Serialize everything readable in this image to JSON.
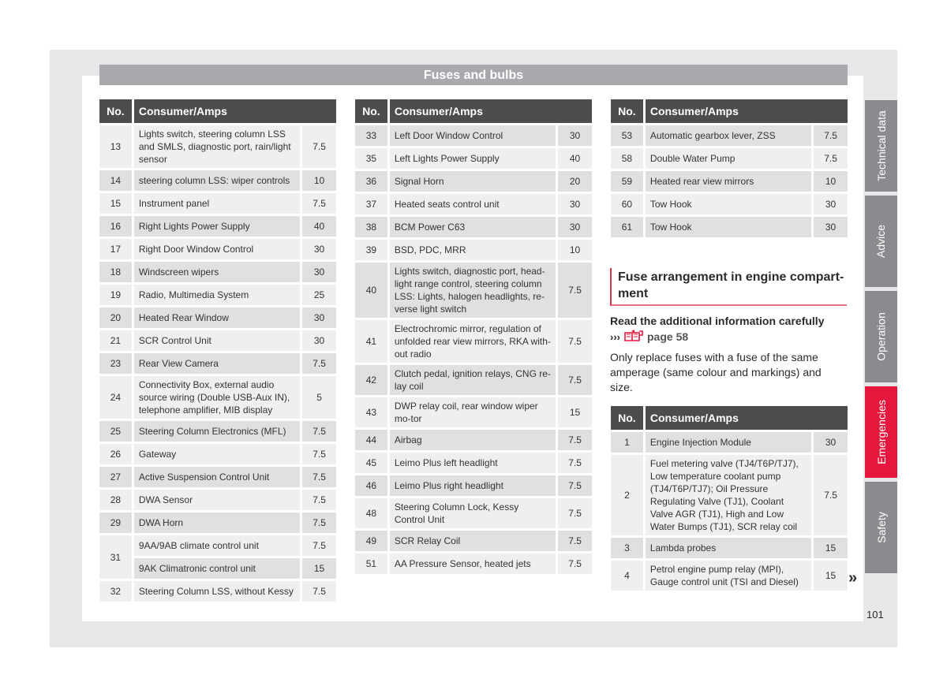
{
  "header": {
    "title": "Fuses and bulbs"
  },
  "columns": {
    "no": "No.",
    "consumer": "Consumer/Amps"
  },
  "table1": {
    "rows": [
      {
        "no": "13",
        "desc": "Lights switch, steering column LSS and SMLS, diagnostic port, rain/light sensor",
        "amps": "7.5"
      },
      {
        "no": "14",
        "desc": "steering column LSS: wiper controls",
        "amps": "10"
      },
      {
        "no": "15",
        "desc": "Instrument panel",
        "amps": "7.5"
      },
      {
        "no": "16",
        "desc": "Right Lights Power Supply",
        "amps": "40"
      },
      {
        "no": "17",
        "desc": "Right Door Window Control",
        "amps": "30"
      },
      {
        "no": "18",
        "desc": "Windscreen wipers",
        "amps": "30"
      },
      {
        "no": "19",
        "desc": "Radio, Multimedia System",
        "amps": "25"
      },
      {
        "no": "20",
        "desc": "Heated Rear Window",
        "amps": "30"
      },
      {
        "no": "21",
        "desc": "SCR Control Unit",
        "amps": "30"
      },
      {
        "no": "23",
        "desc": "Rear View Camera",
        "amps": "7.5"
      },
      {
        "no": "24",
        "desc": "Connectivity Box, external audio source wiring (Double USB-Aux IN), telephone amplifier, MIB display",
        "amps": "5"
      },
      {
        "no": "25",
        "desc": "Steering Column Electronics (MFL)",
        "amps": "7.5"
      },
      {
        "no": "26",
        "desc": "Gateway",
        "amps": "7.5"
      },
      {
        "no": "27",
        "desc": "Active Suspension Control Unit",
        "amps": "7.5"
      },
      {
        "no": "28",
        "desc": "DWA Sensor",
        "amps": "7.5"
      },
      {
        "no": "29",
        "desc": "DWA Horn",
        "amps": "7.5"
      },
      {
        "no": "31",
        "desc": "9AA/9AB climate control unit",
        "amps": "7.5"
      },
      {
        "no": "",
        "desc": "9AK Climatronic control unit",
        "amps": "15"
      },
      {
        "no": "32",
        "desc": "Steering Column LSS, without Kessy",
        "amps": "7.5"
      }
    ]
  },
  "table2": {
    "rows": [
      {
        "no": "33",
        "desc": "Left Door Window Control",
        "amps": "30"
      },
      {
        "no": "35",
        "desc": "Left Lights Power Supply",
        "amps": "40"
      },
      {
        "no": "36",
        "desc": "Signal Horn",
        "amps": "20"
      },
      {
        "no": "37",
        "desc": "Heated seats control unit",
        "amps": "30"
      },
      {
        "no": "38",
        "desc": "BCM Power C63",
        "amps": "30"
      },
      {
        "no": "39",
        "desc": "BSD, PDC, MRR",
        "amps": "10"
      },
      {
        "no": "40",
        "desc": "Lights switch, diagnostic port, head-light range control, steering column LSS: Lights, halogen headlights, re-verse light switch",
        "amps": "7.5"
      },
      {
        "no": "41",
        "desc": "Electrochromic mirror, regulation of unfolded rear view mirrors, RKA with-out radio",
        "amps": "7.5"
      },
      {
        "no": "42",
        "desc": "Clutch pedal, ignition relays, CNG re-lay coil",
        "amps": "7.5"
      },
      {
        "no": "43",
        "desc": "DWP relay coil, rear window wiper mo-tor",
        "amps": "15"
      },
      {
        "no": "44",
        "desc": "Airbag",
        "amps": "7.5"
      },
      {
        "no": "45",
        "desc": "Leimo Plus left headlight",
        "amps": "7.5"
      },
      {
        "no": "46",
        "desc": "Leimo Plus right headlight",
        "amps": "7.5"
      },
      {
        "no": "48",
        "desc": "Steering Column Lock, Kessy Control Unit",
        "amps": "7.5"
      },
      {
        "no": "49",
        "desc": "SCR Relay Coil",
        "amps": "7.5"
      },
      {
        "no": "51",
        "desc": "AA Pressure Sensor, heated jets",
        "amps": "7.5"
      }
    ]
  },
  "table3": {
    "rows": [
      {
        "no": "53",
        "desc": "Automatic gearbox lever, ZSS",
        "amps": "7.5"
      },
      {
        "no": "58",
        "desc": "Double Water Pump",
        "amps": "7.5"
      },
      {
        "no": "59",
        "desc": "Heated rear view mirrors",
        "amps": "10"
      },
      {
        "no": "60",
        "desc": "Tow Hook",
        "amps": "30"
      },
      {
        "no": "61",
        "desc": "Tow Hook",
        "amps": "30"
      }
    ]
  },
  "section": {
    "heading": "Fuse arrangement in engine compart-ment",
    "note_bold": "Read the additional information carefully",
    "note_arrows": "›››",
    "note_ref": "page 58",
    "body": "Only replace fuses with a fuse of the same amperage (same colour and markings) and size."
  },
  "table4": {
    "rows": [
      {
        "no": "1",
        "desc": "Engine Injection Module",
        "amps": "30"
      },
      {
        "no": "2",
        "desc": "Fuel metering valve (TJ4/T6P/TJ7), Low temperature coolant pump (TJ4/T6P/TJ7); Oil Pressure Regulating Valve (TJ1), Coolant Valve AGR (TJ1), High and Low Water Bumps (TJ1), SCR relay coil",
        "amps": "7.5"
      },
      {
        "no": "3",
        "desc": "Lambda probes",
        "amps": "15"
      },
      {
        "no": "4",
        "desc": "Petrol engine pump relay (MPI), Gauge control unit (TSI and Diesel)",
        "amps": "15"
      }
    ]
  },
  "continue_marker": "»",
  "side_tabs": [
    {
      "label": "Technical data",
      "active": false
    },
    {
      "label": "Advice",
      "active": false
    },
    {
      "label": "Operation",
      "active": false
    },
    {
      "label": "Emergencies",
      "active": true
    },
    {
      "label": "Safety",
      "active": false
    }
  ],
  "colors": {
    "accent": "#e5173c",
    "tab": "#8a8b8e",
    "header": "#4d4d4f",
    "title_bar": "#a7a9ac"
  },
  "page_number": "101"
}
